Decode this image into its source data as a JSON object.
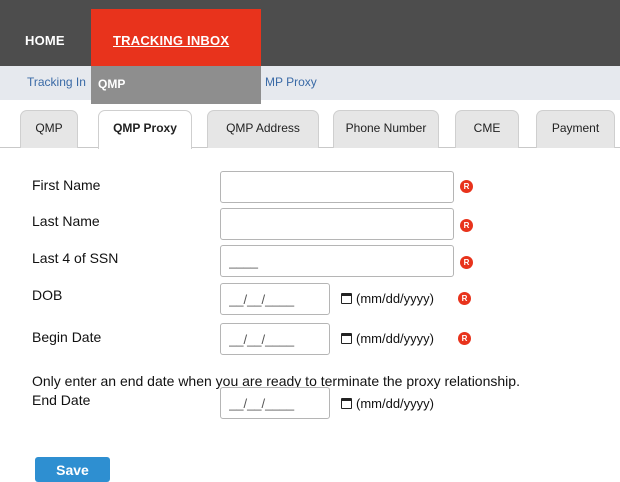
{
  "nav": {
    "home": "HOME",
    "tracking_inbox": "TRACKING INBOX"
  },
  "breadcrumb": {
    "left": "Tracking In",
    "right": "MP Proxy"
  },
  "dropdown": {
    "items": [
      "QMP"
    ]
  },
  "tabs": [
    "QMP",
    "QMP Proxy",
    "QMP Address",
    "Phone Number",
    "CME",
    "Payment"
  ],
  "active_tab": "QMP Proxy",
  "form": {
    "first_name": {
      "label": "First Name",
      "value": ""
    },
    "last_name": {
      "label": "Last Name",
      "value": ""
    },
    "ssn": {
      "label": "Last 4 of SSN",
      "value": "____"
    },
    "dob": {
      "label": "DOB",
      "value": "__/__/____",
      "format": "(mm/dd/yyyy)"
    },
    "begin_date": {
      "label": "Begin Date",
      "value": "__/__/____",
      "format": "(mm/dd/yyyy)"
    },
    "note": "Only enter an end date when you are ready to terminate the proxy relationship.",
    "end_date": {
      "label": "End Date",
      "value": "__/__/____",
      "format": "(mm/dd/yyyy)"
    },
    "required_marker": "R"
  },
  "save_label": "Save",
  "colors": {
    "nav_bg": "#4d4d4d",
    "accent_red": "#e8331c",
    "crumb_bg": "#e6e9ee",
    "link_blue": "#3a6aa6",
    "button_blue": "#2e8fd1"
  },
  "icons": {
    "calendar": "calendar-icon",
    "required": "required-icon"
  }
}
